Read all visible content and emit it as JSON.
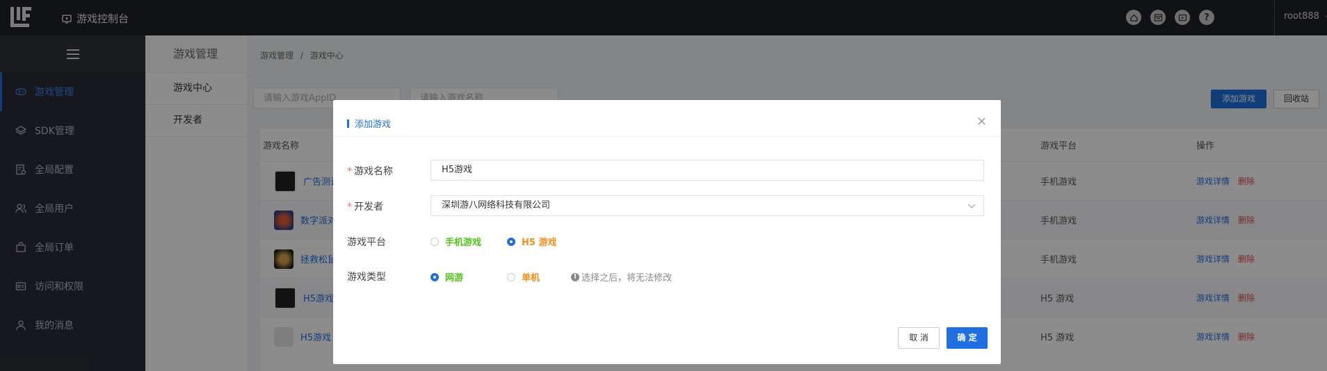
{
  "header": {
    "console_label": "游戏控制台",
    "icons": [
      "home-icon",
      "browser-icon",
      "media-icon",
      "help-icon"
    ],
    "help_glyph": "?",
    "user": "root888"
  },
  "sidebar": {
    "items": [
      {
        "label": "游戏管理",
        "icon": "gamepad-icon",
        "active": true
      },
      {
        "label": "SDK管理",
        "icon": "layers-icon"
      },
      {
        "label": "全局配置",
        "icon": "settings-doc-icon"
      },
      {
        "label": "全局用户",
        "icon": "users-icon"
      },
      {
        "label": "全局订单",
        "icon": "bag-icon"
      },
      {
        "label": "访问和权限",
        "icon": "key-icon"
      },
      {
        "label": "我的消息",
        "icon": "user-icon"
      }
    ]
  },
  "subsidebar": {
    "title": "游戏管理",
    "items": [
      "游戏中心",
      "开发者"
    ]
  },
  "main": {
    "breadcrumb": [
      "游戏管理",
      "游戏中心"
    ],
    "breadcrumb_sep": "/",
    "search_appid_placeholder": "请输入游戏AppID",
    "search_name_placeholder": "请输入游戏名称",
    "add_button": "添加游戏",
    "recycle_button": "回收站",
    "table": {
      "headers": {
        "name": "游戏名称",
        "platform": "游戏平台",
        "ops": "操作"
      },
      "rows": [
        {
          "name": "广告测试",
          "platform": "手机游戏"
        },
        {
          "name": "数字派对",
          "platform": "手机游戏"
        },
        {
          "name": "拯救松鼠",
          "platform": "手机游戏"
        },
        {
          "name": "H5游戏聚",
          "platform": "H5 游戏"
        },
        {
          "name": "H5游戏",
          "platform": "H5 游戏"
        }
      ],
      "op_detail": "游戏详情",
      "op_delete": "删除"
    }
  },
  "modal": {
    "title": "添加游戏",
    "close_glyph": "×",
    "fields": {
      "name_label": "游戏名称",
      "name_value": "H5游戏",
      "developer_label": "开发者",
      "developer_value": "深圳游八网络科技有限公司",
      "platform_label": "游戏平台",
      "platform_opt1": "手机游戏",
      "platform_opt2": "H5 游戏",
      "platform_selected": "H5 游戏",
      "type_label": "游戏类型",
      "type_opt1": "网游",
      "type_opt2": "单机",
      "type_selected": "网游",
      "type_hint": "选择之后，将无法修改"
    },
    "required_mark": "*",
    "cancel": "取 消",
    "confirm": "确 定",
    "colors": {
      "green": "#52c41a",
      "orange": "#fa8c16",
      "primary": "#1f6fe0"
    }
  }
}
